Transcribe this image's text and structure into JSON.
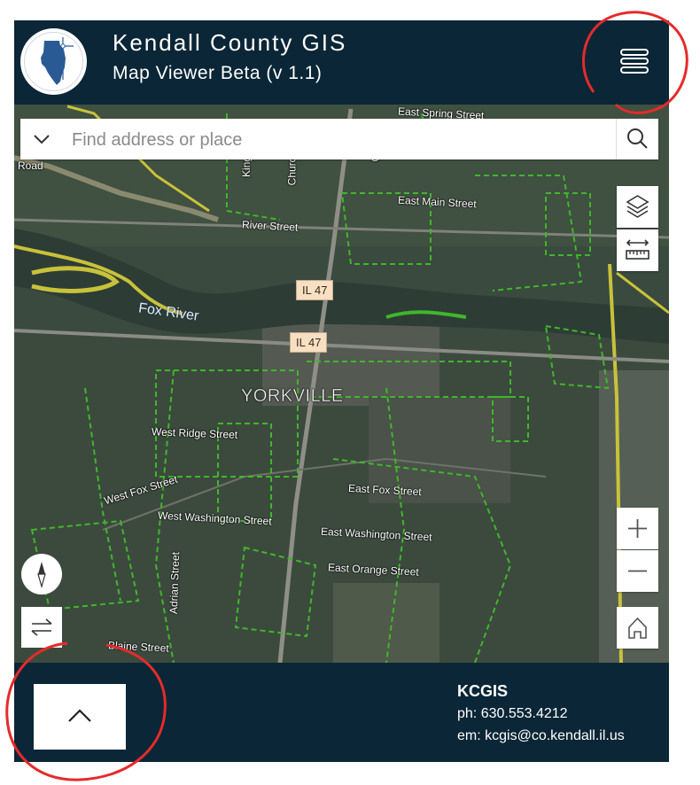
{
  "header": {
    "title": "Kendall County GIS",
    "subtitle": "Map Viewer Beta (v 1.1)",
    "logo_icon": "illinois-state-logo",
    "menu_icon": "hamburger-menu-icon"
  },
  "search": {
    "placeholder": "Find address or place",
    "dropdown_icon": "chevron-down-icon",
    "search_icon": "search-icon"
  },
  "map": {
    "town_label": "YORKVILLE",
    "river_label": "Fox River",
    "route_shields": [
      "IL 47",
      "IL 47"
    ],
    "street_labels": [
      "East Spring Street",
      "East Main Street",
      "River Street",
      "Road",
      "West Ridge Street",
      "West Fox Street",
      "East Fox Street",
      "West Washington Street",
      "East Washington Street",
      "East Orange Street",
      "Adrian Street",
      "Blaine Street",
      "Kings",
      "Church",
      "Ch"
    ],
    "controls": {
      "layers_icon": "layers-icon",
      "measure_icon": "measure-icon",
      "zoom_in_icon": "plus-icon",
      "zoom_out_icon": "minus-icon",
      "home_icon": "home-icon",
      "compass_icon": "compass-icon",
      "swap_icon": "swap-icon"
    }
  },
  "footer": {
    "expand_icon": "chevron-up-icon",
    "contact_name": "KCGIS",
    "phone": "ph: 630.553.4212",
    "email": "em: kcgis@co.kendall.il.us"
  },
  "colors": {
    "header_bg": "#0b2636",
    "annotation_circle": "#e52b2b",
    "parcel_line": "#3fb72a",
    "boundary_line": "#c8c23a"
  }
}
